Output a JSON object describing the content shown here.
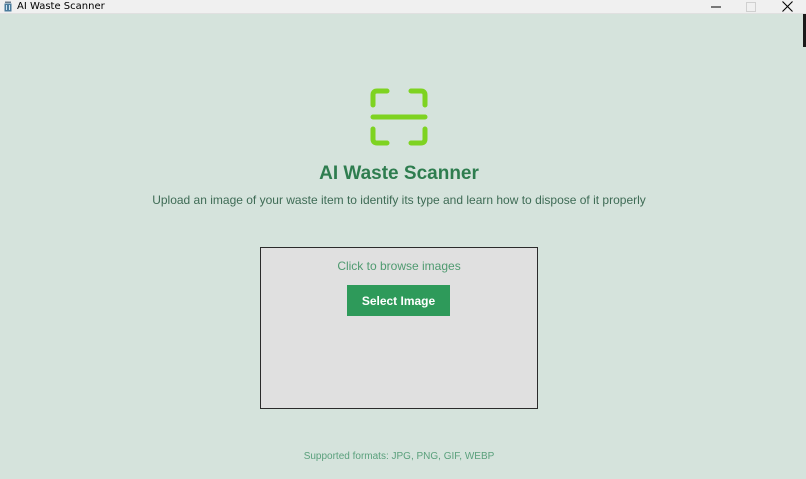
{
  "window": {
    "title": "AI Waste Scanner",
    "minimize_icon": "minimize-icon",
    "maximize_icon": "maximize-icon",
    "close_icon": "close-icon"
  },
  "main": {
    "icon": "scan-icon",
    "icon_color": "#7ed321",
    "heading": "AI Waste Scanner",
    "subtitle": "Upload an image of your waste item to identify its type and learn how to dispose of it properly"
  },
  "upload": {
    "hint": "Click to browse images",
    "button_label": "Select Image",
    "button_color": "#2e9a5a"
  },
  "footer": {
    "formats": "Supported formats: JPG, PNG, GIF, WEBP"
  },
  "colors": {
    "background": "#d5e3dc",
    "heading": "#2e7d4f",
    "dropzone": "#e0e0e0"
  }
}
